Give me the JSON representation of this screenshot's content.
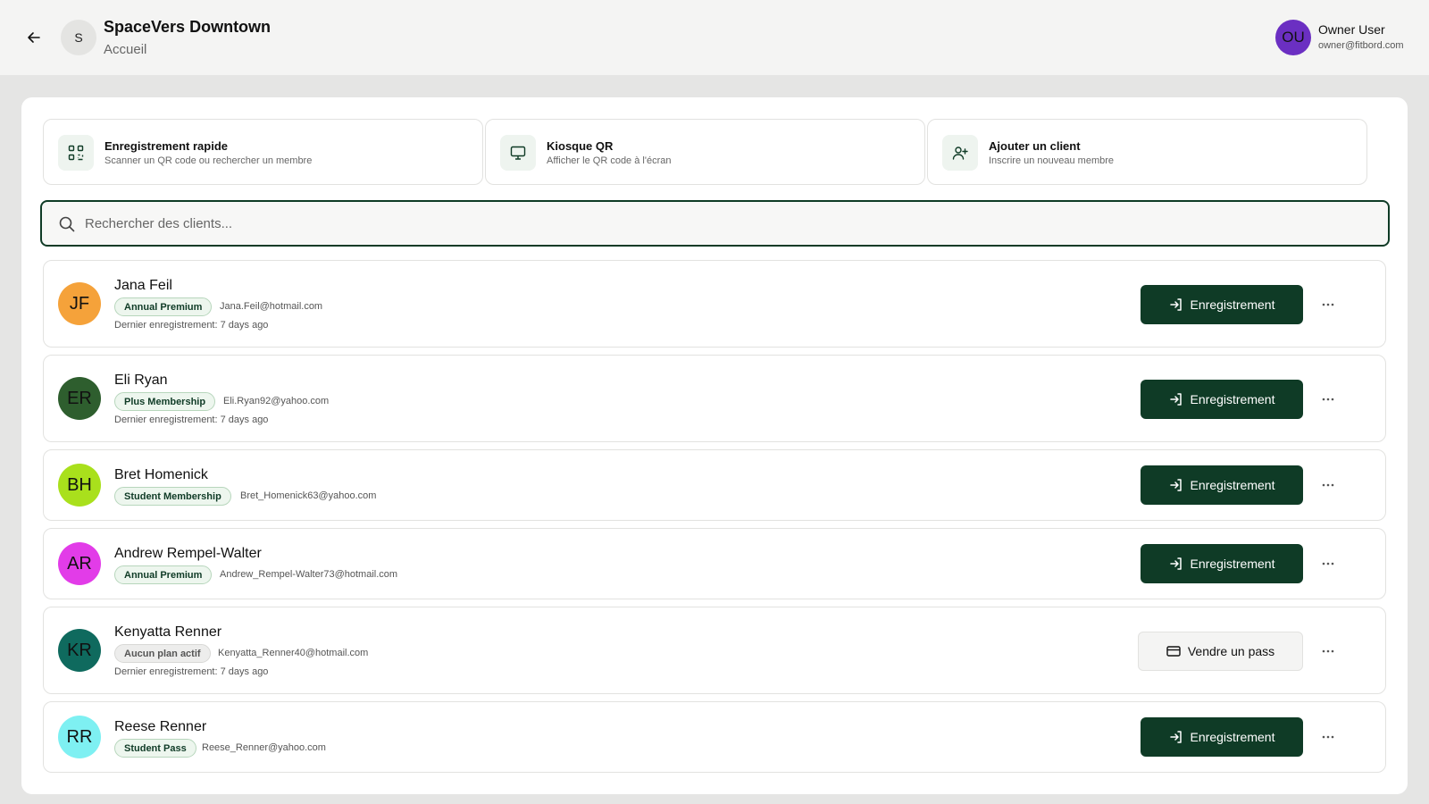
{
  "header": {
    "org_initial": "S",
    "org_name": "SpaceVers Downtown",
    "org_subtitle": "Accueil",
    "user_initials": "OU",
    "user_name": "Owner User",
    "user_email": "owner@fitbord.com"
  },
  "actions": [
    {
      "title": "Enregistrement rapide",
      "desc": "Scanner un QR code ou rechercher un membre",
      "icon": "qr-code-icon"
    },
    {
      "title": "Kiosque QR",
      "desc": "Afficher le QR code à l'écran",
      "icon": "monitor-icon"
    },
    {
      "title": "Ajouter un client",
      "desc": "Inscrire un nouveau membre",
      "icon": "user-plus-icon"
    }
  ],
  "search": {
    "placeholder": "Rechercher des clients..."
  },
  "members": [
    {
      "initials": "JF",
      "name": "Jana Feil",
      "plan": "Annual Premium",
      "email": "Jana.Feil@hotmail.com",
      "last_checkin": "Dernier enregistrement: 7 days ago",
      "action": "Enregistrement",
      "avatar_color": "#f5a23a"
    },
    {
      "initials": "ER",
      "name": "Eli Ryan",
      "plan": "Plus Membership",
      "email": "Eli.Ryan92@yahoo.com",
      "last_checkin": "Dernier enregistrement: 7 days ago",
      "action": "Enregistrement",
      "avatar_color": "#2e5e2e"
    },
    {
      "initials": "BH",
      "name": "Bret Homenick",
      "plan": "Student Membership",
      "email": "Bret_Homenick63@yahoo.com",
      "last_checkin": "",
      "action": "Enregistrement",
      "avatar_color": "#a9e01c"
    },
    {
      "initials": "AR",
      "name": "Andrew Rempel-Walter",
      "plan": "Annual Premium",
      "email": "Andrew_Rempel-Walter73@hotmail.com",
      "last_checkin": "",
      "action": "Enregistrement",
      "avatar_color": "#e23ce8"
    },
    {
      "initials": "KR",
      "name": "Kenyatta Renner",
      "plan": "Aucun plan actif",
      "email": "Kenyatta_Renner40@hotmail.com",
      "last_checkin": "Dernier enregistrement: 7 days ago",
      "action": "Vendre un pass",
      "avatar_color": "#0f6a5e"
    },
    {
      "initials": "RR",
      "name": "Reese Renner",
      "plan": "Student Pass",
      "email": "Reese_Renner@yahoo.com",
      "last_checkin": "",
      "action": "Enregistrement",
      "avatar_color": "#7ef0f2"
    }
  ],
  "colors": {
    "primary": "#0f3b26",
    "background": "#e5e5e4"
  }
}
